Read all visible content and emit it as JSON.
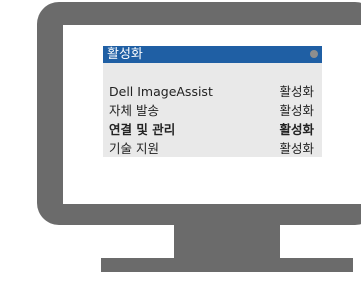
{
  "osd": {
    "header_title": "활성화",
    "rows": [
      {
        "label": "Dell ImageAssist",
        "value": "활성화"
      },
      {
        "label": "자체 발송",
        "value": "활성화"
      },
      {
        "label": "연결 및 관리",
        "value": "활성화"
      },
      {
        "label": "기술 지원",
        "value": "활성화"
      }
    ]
  },
  "colors": {
    "bezel": "#6b6b6b",
    "header": "#1f5fa4",
    "panel": "#e9e9e9"
  },
  "icons": {
    "header_indicator": "status-dot-icon",
    "device": "monitor-icon"
  }
}
